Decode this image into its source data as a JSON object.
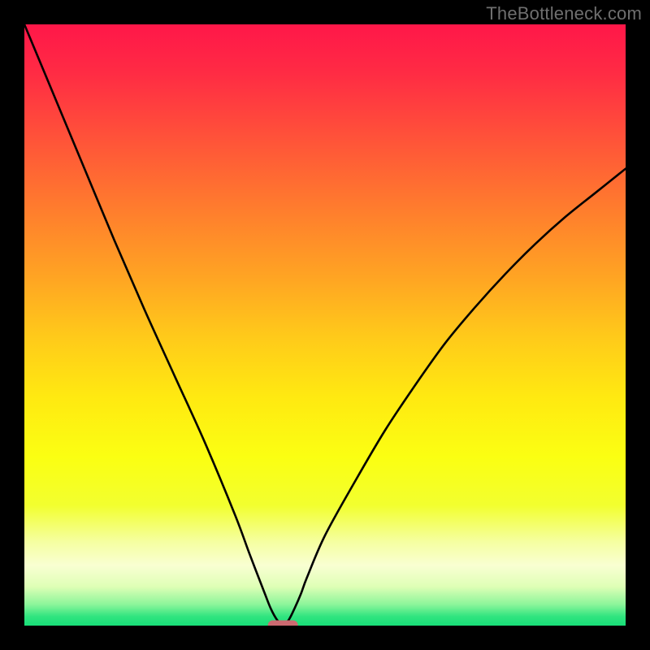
{
  "watermark": "TheBottleneck.com",
  "chart_data": {
    "type": "line",
    "title": "",
    "xlabel": "",
    "ylabel": "",
    "xlim": [
      0,
      100
    ],
    "ylim": [
      0,
      100
    ],
    "x": [
      0,
      5,
      10,
      15,
      20,
      25,
      30,
      35,
      37.5,
      40,
      41,
      42,
      43,
      44,
      45,
      46,
      47,
      50,
      55,
      60,
      65,
      70,
      75,
      80,
      85,
      90,
      95,
      100
    ],
    "values": [
      100,
      88,
      76,
      64,
      52.5,
      41.5,
      30.5,
      18.5,
      11.8,
      5.3,
      2.8,
      1.0,
      0.0,
      1.0,
      3.0,
      5.3,
      8.0,
      15.0,
      24.0,
      32.5,
      40.0,
      47.0,
      53.0,
      58.5,
      63.5,
      68.0,
      72.0,
      76.0
    ],
    "vertex_x": 43,
    "marker": {
      "x_range": [
        40.5,
        45.5
      ],
      "y": 0,
      "color": "#cc6a71"
    },
    "gradient_stops": [
      {
        "pos": 0.0,
        "color": "#ff1749"
      },
      {
        "pos": 0.08,
        "color": "#ff2b44"
      },
      {
        "pos": 0.18,
        "color": "#ff4f3a"
      },
      {
        "pos": 0.3,
        "color": "#ff7a2e"
      },
      {
        "pos": 0.42,
        "color": "#ffa423"
      },
      {
        "pos": 0.52,
        "color": "#ffca1a"
      },
      {
        "pos": 0.62,
        "color": "#ffe911"
      },
      {
        "pos": 0.72,
        "color": "#fbff12"
      },
      {
        "pos": 0.8,
        "color": "#f2ff2f"
      },
      {
        "pos": 0.86,
        "color": "#f5ffa0"
      },
      {
        "pos": 0.9,
        "color": "#f9ffd2"
      },
      {
        "pos": 0.935,
        "color": "#dfffb6"
      },
      {
        "pos": 0.965,
        "color": "#8bf59a"
      },
      {
        "pos": 0.985,
        "color": "#2fe47f"
      },
      {
        "pos": 1.0,
        "color": "#18df78"
      }
    ]
  }
}
